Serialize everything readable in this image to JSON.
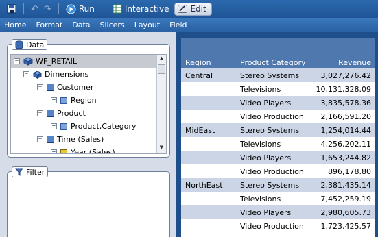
{
  "toolbar": {
    "run_label": "Run",
    "interactive_label": "Interactive",
    "edit_label": "Edit"
  },
  "menu": [
    "Home",
    "Format",
    "Data",
    "Slicers",
    "Layout",
    "Field"
  ],
  "data_panel": {
    "title": "Data",
    "tree": {
      "root": "WF_RETAIL",
      "dimensions": "Dimensions",
      "customer": "Customer",
      "region": "Region",
      "product": "Product",
      "product_category": "Product,Category",
      "time": "Time (Sales)",
      "year": "Year,(Sales)"
    }
  },
  "filter_panel": {
    "title": "Filter"
  },
  "report": {
    "headers": {
      "region": "Region",
      "category": "Product Category",
      "revenue": "Revenue"
    },
    "rows": [
      [
        "Central",
        "Stereo Systems",
        "3,027,276.42"
      ],
      [
        "",
        "Televisions",
        "10,131,328.09"
      ],
      [
        "",
        "Video Players",
        "3,835,578.36"
      ],
      [
        "",
        "Video Production",
        "2,166,591.20"
      ],
      [
        "MidEast",
        "Stereo Systems",
        "1,254,014.44"
      ],
      [
        "",
        "Televisions",
        "4,256,202.11"
      ],
      [
        "",
        "Video Players",
        "1,653,244.82"
      ],
      [
        "",
        "Video Production",
        "896,178.80"
      ],
      [
        "NorthEast",
        "Stereo Systems",
        "2,381,435.14"
      ],
      [
        "",
        "Televisions",
        "7,452,259.19"
      ],
      [
        "",
        "Video Players",
        "2,980,605.73"
      ],
      [
        "",
        "Video Production",
        "1,723,425.57"
      ]
    ]
  }
}
